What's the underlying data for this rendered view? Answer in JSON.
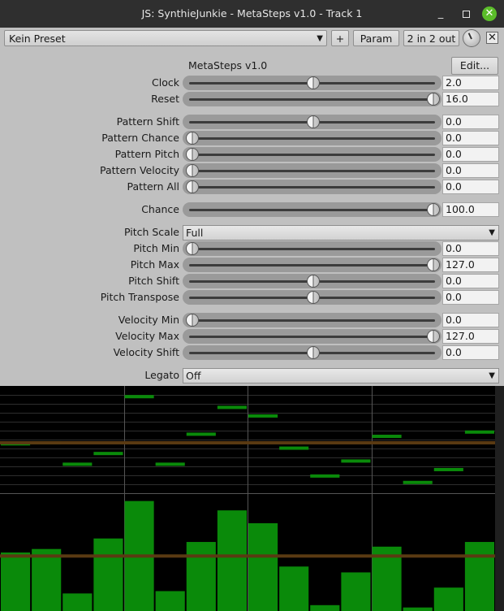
{
  "window": {
    "title": "JS: SynthieJunkie - MetaSteps v1.0 - Track 1",
    "minimize_glyph": "_",
    "close_glyph": "✕"
  },
  "toolbar": {
    "preset": "Kein Preset",
    "preset_arrow": "▼",
    "plus_label": "+",
    "param_label": "Param",
    "io_label": "2 in 2 out",
    "bypass_glyph": "✕"
  },
  "plugin": {
    "name": "MetaSteps v1.0",
    "edit_label": "Edit..."
  },
  "sliders": [
    {
      "id": "clock",
      "label": "Clock",
      "value": "2.0",
      "pos": 0.5
    },
    {
      "id": "reset",
      "label": "Reset",
      "value": "16.0",
      "pos": 1.0
    },
    {
      "id": "pattern-shift",
      "label": "Pattern Shift",
      "value": "0.0",
      "pos": 0.5
    },
    {
      "id": "pattern-chance",
      "label": "Pattern Chance",
      "value": "0.0",
      "pos": 0.0
    },
    {
      "id": "pattern-pitch",
      "label": "Pattern Pitch",
      "value": "0.0",
      "pos": 0.0
    },
    {
      "id": "pattern-velocity",
      "label": "Pattern Velocity",
      "value": "0.0",
      "pos": 0.0
    },
    {
      "id": "pattern-all",
      "label": "Pattern All",
      "value": "0.0",
      "pos": 0.0
    },
    {
      "id": "chance",
      "label": "Chance",
      "value": "100.0",
      "pos": 1.0
    },
    {
      "id": "pitch-min",
      "label": "Pitch Min",
      "value": "0.0",
      "pos": 0.0
    },
    {
      "id": "pitch-max",
      "label": "Pitch Max",
      "value": "127.0",
      "pos": 1.0
    },
    {
      "id": "pitch-shift",
      "label": "Pitch Shift",
      "value": "0.0",
      "pos": 0.5
    },
    {
      "id": "pitch-transpose",
      "label": "Pitch Transpose",
      "value": "0.0",
      "pos": 0.5
    },
    {
      "id": "velocity-min",
      "label": "Velocity Min",
      "value": "0.0",
      "pos": 0.0
    },
    {
      "id": "velocity-max",
      "label": "Velocity Max",
      "value": "127.0",
      "pos": 1.0
    },
    {
      "id": "velocity-shift",
      "label": "Velocity Shift",
      "value": "0.0",
      "pos": 0.5
    }
  ],
  "dropdowns": {
    "pitch_scale": {
      "label": "Pitch Scale",
      "value": "Full"
    },
    "legato": {
      "label": "Legato",
      "value": "Off"
    },
    "arrow": "▼"
  },
  "visual": {
    "colors": {
      "step": "#0a8a0a",
      "marker": "#5a3a12",
      "grid": "#555555",
      "background": "#000000"
    },
    "pitch_steps": [
      0.46,
      0.47,
      0.27,
      0.37,
      0.9,
      0.27,
      0.55,
      0.8,
      0.72,
      0.42,
      0.16,
      0.3,
      0.53,
      0.1,
      0.22,
      0.57
    ],
    "velocity_steps": [
      0.5,
      0.53,
      0.15,
      0.62,
      0.94,
      0.17,
      0.59,
      0.86,
      0.75,
      0.38,
      0.05,
      0.33,
      0.55,
      0.03,
      0.2,
      0.59
    ],
    "marker_level": 0.47
  }
}
